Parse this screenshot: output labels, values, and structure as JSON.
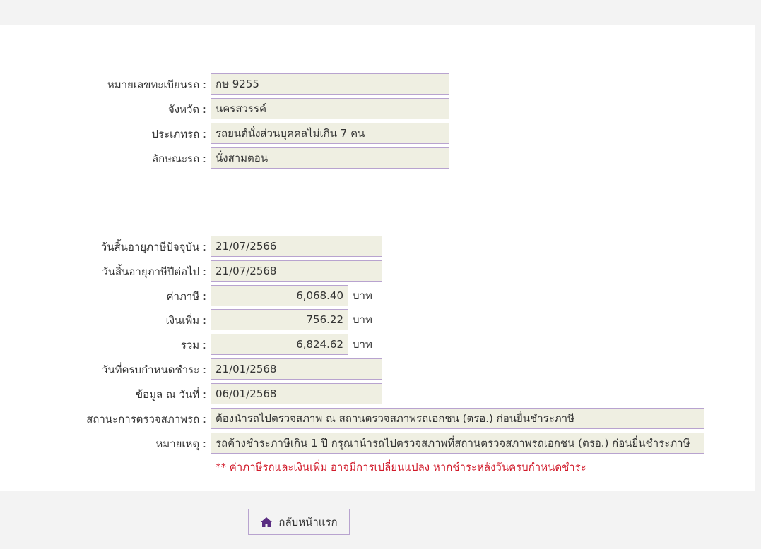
{
  "vehicle": {
    "plate_label": "หมายเลขทะเบียนรถ :",
    "plate_value": "กษ 9255",
    "province_label": "จังหวัด :",
    "province_value": "นครสวรรค์",
    "type_label": "ประเภทรถ :",
    "type_value": "รถยนต์นั่งส่วนบุคคลไม่เกิน 7 คน",
    "style_label": "ลักษณะรถ :",
    "style_value": "นั่งสามตอน"
  },
  "tax": {
    "current_expiry_label": "วันสิ้นอายุภาษีปัจจุบัน :",
    "current_expiry_value": "21/07/2566",
    "next_expiry_label": "วันสิ้นอายุภาษีปีต่อไป :",
    "next_expiry_value": "21/07/2568",
    "tax_label": "ค่าภาษี :",
    "tax_value": "6,068.40",
    "surcharge_label": "เงินเพิ่ม :",
    "surcharge_value": "756.22",
    "total_label": "รวม :",
    "total_value": "6,824.62",
    "unit": "บาท",
    "due_date_label": "วันที่ครบกำหนดชำระ :",
    "due_date_value": "21/01/2568",
    "data_as_of_label": "ข้อมูล ณ วันที่ :",
    "data_as_of_value": "06/01/2568",
    "inspection_label": "สถานะการตรวจสภาพรถ :",
    "inspection_value": "ต้องนำรถไปตรวจสภาพ ณ สถานตรวจสภาพรถเอกชน (ตรอ.) ก่อนยื่นชำระภาษี",
    "remark_label": "หมายเหตุ :",
    "remark_value": "รถค้างชำระภาษีเกิน 1 ปี กรุณานำรถไปตรวจสภาพที่สถานตรวจสภาพรถเอกชน (ตรอ.) ก่อนยื่นชำระภาษี",
    "warning_note": "** ค่าภาษีรถและเงินเพิ่ม อาจมีการเปลี่ยนแปลง หากชำระหลังวันครบกำหนดชำระ"
  },
  "footer": {
    "home_button_label": "กลับหน้าแรก",
    "home_icon": "home-icon"
  },
  "colors": {
    "field_border": "#b8a3cf",
    "field_background": "#efefe2",
    "warning_text": "#d11a2a",
    "icon_purple": "#5a2d82"
  }
}
